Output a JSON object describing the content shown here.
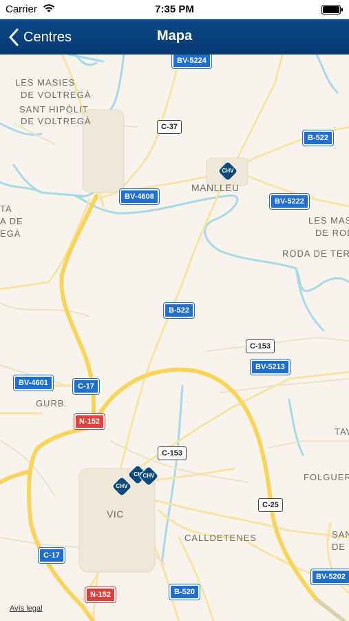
{
  "status_bar": {
    "carrier": "Carrier",
    "time": "7:35 PM"
  },
  "nav_bar": {
    "back_label": "Centres",
    "title": "Mapa"
  },
  "map": {
    "places": [
      {
        "name": "LES MASIES",
        "id": "les-masies-1"
      },
      {
        "name": "DE VOLTREGÀ",
        "id": "de-voltrega-1"
      },
      {
        "name": "SANT HIPÒLIT",
        "id": "sant-hipolit"
      },
      {
        "name": "DE VOLTREGÀ",
        "id": "de-voltrega-2"
      },
      {
        "name": "MANLLEU",
        "id": "manlleu"
      },
      {
        "name": "LES MASI",
        "id": "les-masies-2"
      },
      {
        "name": "DE ROD",
        "id": "de-rod"
      },
      {
        "name": "RODA DE TER",
        "id": "roda-de-ter"
      },
      {
        "name": "GURB",
        "id": "gurb"
      },
      {
        "name": "TAV",
        "id": "tav"
      },
      {
        "name": "FOLGUERO",
        "id": "folguero"
      },
      {
        "name": "VIC",
        "id": "vic"
      },
      {
        "name": "CALLDETENES",
        "id": "calldetenes"
      },
      {
        "name": "SAN",
        "id": "san"
      },
      {
        "name": "DE V",
        "id": "de-v"
      },
      {
        "name": "TA",
        "id": "ta"
      },
      {
        "name": "A DE",
        "id": "a-de"
      },
      {
        "name": "EGÀ",
        "id": "ega"
      }
    ],
    "roads": [
      {
        "code": "BV-5224",
        "style": "blue"
      },
      {
        "code": "C-37",
        "style": "white"
      },
      {
        "code": "B-522",
        "style": "blue"
      },
      {
        "code": "BV-4608",
        "style": "blue"
      },
      {
        "code": "BV-5222",
        "style": "blue"
      },
      {
        "code": "B-522",
        "style": "blue"
      },
      {
        "code": "C-153",
        "style": "white"
      },
      {
        "code": "BV-5213",
        "style": "blue"
      },
      {
        "code": "BV-4601",
        "style": "blue"
      },
      {
        "code": "C-17",
        "style": "blue"
      },
      {
        "code": "N-152",
        "style": "red"
      },
      {
        "code": "C-153",
        "style": "white"
      },
      {
        "code": "C-25",
        "style": "white"
      },
      {
        "code": "C-17",
        "style": "blue"
      },
      {
        "code": "N-152",
        "style": "red"
      },
      {
        "code": "B-520",
        "style": "blue"
      },
      {
        "code": "BV-5202",
        "style": "blue"
      }
    ],
    "pins": [
      {
        "label": "CHV",
        "name": "manlleu"
      },
      {
        "label": "CHV",
        "name": "vic-1"
      },
      {
        "label": "CH",
        "name": "vic-2"
      },
      {
        "label": "CHV",
        "name": "vic-3"
      }
    ],
    "legal_label": "Avís legal"
  },
  "colors": {
    "nav": "#0a4787",
    "land": "#f8f4ec",
    "water": "#a8d8ea",
    "highway": "#f9d45c"
  }
}
